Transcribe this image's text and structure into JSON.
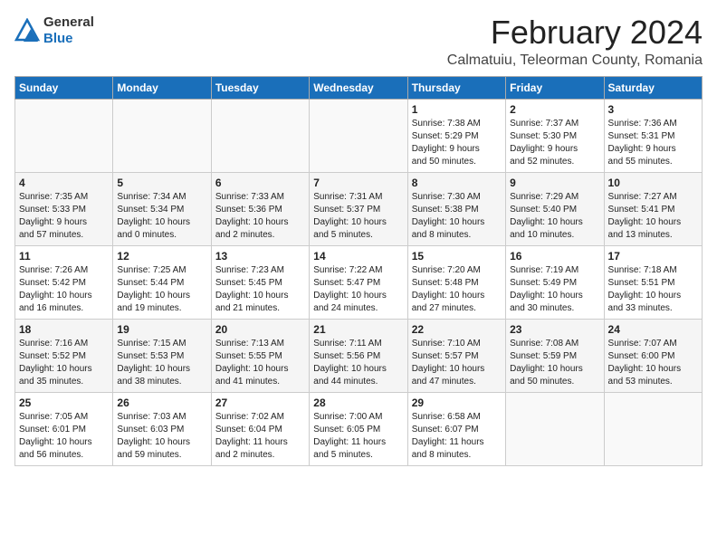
{
  "header": {
    "logo_general": "General",
    "logo_blue": "Blue",
    "month_title": "February 2024",
    "subtitle": "Calmatuiu, Teleorman County, Romania"
  },
  "weekdays": [
    "Sunday",
    "Monday",
    "Tuesday",
    "Wednesday",
    "Thursday",
    "Friday",
    "Saturday"
  ],
  "weeks": [
    [
      {
        "day": "",
        "info": ""
      },
      {
        "day": "",
        "info": ""
      },
      {
        "day": "",
        "info": ""
      },
      {
        "day": "",
        "info": ""
      },
      {
        "day": "1",
        "info": "Sunrise: 7:38 AM\nSunset: 5:29 PM\nDaylight: 9 hours\nand 50 minutes."
      },
      {
        "day": "2",
        "info": "Sunrise: 7:37 AM\nSunset: 5:30 PM\nDaylight: 9 hours\nand 52 minutes."
      },
      {
        "day": "3",
        "info": "Sunrise: 7:36 AM\nSunset: 5:31 PM\nDaylight: 9 hours\nand 55 minutes."
      }
    ],
    [
      {
        "day": "4",
        "info": "Sunrise: 7:35 AM\nSunset: 5:33 PM\nDaylight: 9 hours\nand 57 minutes."
      },
      {
        "day": "5",
        "info": "Sunrise: 7:34 AM\nSunset: 5:34 PM\nDaylight: 10 hours\nand 0 minutes."
      },
      {
        "day": "6",
        "info": "Sunrise: 7:33 AM\nSunset: 5:36 PM\nDaylight: 10 hours\nand 2 minutes."
      },
      {
        "day": "7",
        "info": "Sunrise: 7:31 AM\nSunset: 5:37 PM\nDaylight: 10 hours\nand 5 minutes."
      },
      {
        "day": "8",
        "info": "Sunrise: 7:30 AM\nSunset: 5:38 PM\nDaylight: 10 hours\nand 8 minutes."
      },
      {
        "day": "9",
        "info": "Sunrise: 7:29 AM\nSunset: 5:40 PM\nDaylight: 10 hours\nand 10 minutes."
      },
      {
        "day": "10",
        "info": "Sunrise: 7:27 AM\nSunset: 5:41 PM\nDaylight: 10 hours\nand 13 minutes."
      }
    ],
    [
      {
        "day": "11",
        "info": "Sunrise: 7:26 AM\nSunset: 5:42 PM\nDaylight: 10 hours\nand 16 minutes."
      },
      {
        "day": "12",
        "info": "Sunrise: 7:25 AM\nSunset: 5:44 PM\nDaylight: 10 hours\nand 19 minutes."
      },
      {
        "day": "13",
        "info": "Sunrise: 7:23 AM\nSunset: 5:45 PM\nDaylight: 10 hours\nand 21 minutes."
      },
      {
        "day": "14",
        "info": "Sunrise: 7:22 AM\nSunset: 5:47 PM\nDaylight: 10 hours\nand 24 minutes."
      },
      {
        "day": "15",
        "info": "Sunrise: 7:20 AM\nSunset: 5:48 PM\nDaylight: 10 hours\nand 27 minutes."
      },
      {
        "day": "16",
        "info": "Sunrise: 7:19 AM\nSunset: 5:49 PM\nDaylight: 10 hours\nand 30 minutes."
      },
      {
        "day": "17",
        "info": "Sunrise: 7:18 AM\nSunset: 5:51 PM\nDaylight: 10 hours\nand 33 minutes."
      }
    ],
    [
      {
        "day": "18",
        "info": "Sunrise: 7:16 AM\nSunset: 5:52 PM\nDaylight: 10 hours\nand 35 minutes."
      },
      {
        "day": "19",
        "info": "Sunrise: 7:15 AM\nSunset: 5:53 PM\nDaylight: 10 hours\nand 38 minutes."
      },
      {
        "day": "20",
        "info": "Sunrise: 7:13 AM\nSunset: 5:55 PM\nDaylight: 10 hours\nand 41 minutes."
      },
      {
        "day": "21",
        "info": "Sunrise: 7:11 AM\nSunset: 5:56 PM\nDaylight: 10 hours\nand 44 minutes."
      },
      {
        "day": "22",
        "info": "Sunrise: 7:10 AM\nSunset: 5:57 PM\nDaylight: 10 hours\nand 47 minutes."
      },
      {
        "day": "23",
        "info": "Sunrise: 7:08 AM\nSunset: 5:59 PM\nDaylight: 10 hours\nand 50 minutes."
      },
      {
        "day": "24",
        "info": "Sunrise: 7:07 AM\nSunset: 6:00 PM\nDaylight: 10 hours\nand 53 minutes."
      }
    ],
    [
      {
        "day": "25",
        "info": "Sunrise: 7:05 AM\nSunset: 6:01 PM\nDaylight: 10 hours\nand 56 minutes."
      },
      {
        "day": "26",
        "info": "Sunrise: 7:03 AM\nSunset: 6:03 PM\nDaylight: 10 hours\nand 59 minutes."
      },
      {
        "day": "27",
        "info": "Sunrise: 7:02 AM\nSunset: 6:04 PM\nDaylight: 11 hours\nand 2 minutes."
      },
      {
        "day": "28",
        "info": "Sunrise: 7:00 AM\nSunset: 6:05 PM\nDaylight: 11 hours\nand 5 minutes."
      },
      {
        "day": "29",
        "info": "Sunrise: 6:58 AM\nSunset: 6:07 PM\nDaylight: 11 hours\nand 8 minutes."
      },
      {
        "day": "",
        "info": ""
      },
      {
        "day": "",
        "info": ""
      }
    ]
  ]
}
